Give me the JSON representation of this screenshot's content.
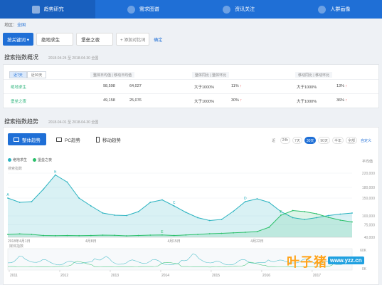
{
  "nav": {
    "tabs": [
      {
        "label": "趋势研究",
        "icon": "chart-icon"
      },
      {
        "label": "需求图谱",
        "icon": "graph-icon"
      },
      {
        "label": "资讯关注",
        "icon": "news-icon"
      },
      {
        "label": "人群画像",
        "icon": "person-icon"
      }
    ]
  },
  "region": {
    "label": "地区：",
    "value": "全国"
  },
  "keywords": {
    "compare_button": "按关键词 ▾",
    "items": [
      "绝地求生",
      "堡垒之夜"
    ],
    "add_label": "+ 添加对比词",
    "confirm": "确定"
  },
  "overview": {
    "title": "搜索指数概况",
    "date": "2018-04-24 至 2018-04-30  全国",
    "toggle": [
      "近7天",
      "近30天"
    ],
    "headers": {
      "index": "整体日均值 | 移动日均值",
      "yoy": "整体同比 | 整体环比",
      "mobile": "移动同比 | 移动环比"
    },
    "rows": [
      {
        "name": "绝地求生",
        "overall": "98,598",
        "mobile": "64,027",
        "yoy": "大于1000%",
        "qoq": "11%",
        "m_yoy": "大于1000%",
        "m_qoq": "13%"
      },
      {
        "name": "堡垒之夜",
        "overall": "49,158",
        "mobile": "25,076",
        "yoy": "大于1000%",
        "qoq": "30%",
        "m_yoy": "大于1000%",
        "m_qoq": "36%"
      }
    ]
  },
  "trend": {
    "title": "搜索指数趋势",
    "date": "2018-04-01 至 2018-04-30  全国",
    "tabs": [
      "整体趋势",
      "PC趋势",
      "移动趋势"
    ],
    "ranges": [
      "近",
      "24h",
      "7天",
      "30天",
      "90天",
      "半年",
      "全部",
      "自定义"
    ],
    "active_range": "30天",
    "avg_label": "平均值",
    "ylabel": "搜索指数"
  },
  "chart_data": {
    "type": "area",
    "x": [
      "2018年4月1日",
      "4/2",
      "4/3",
      "4/4",
      "4/5",
      "4/6",
      "4/7",
      "4/8",
      "4/9",
      "4/10",
      "4/11",
      "4/12",
      "4/13",
      "4/14",
      "4/15",
      "4/16",
      "4/17",
      "4/18",
      "4/19",
      "4/20",
      "4/21",
      "4/22",
      "4/23",
      "4/24",
      "4/25",
      "4/26",
      "4/27",
      "4/28",
      "4/29",
      "4/30"
    ],
    "x_ticks": [
      "2018年4月1日",
      "4月8日",
      "4月15日",
      "4月22日"
    ],
    "series": [
      {
        "name": "绝地求生",
        "color": "#2bb3c0",
        "values": [
          150000,
          138000,
          140000,
          175000,
          215000,
          195000,
          150000,
          128000,
          108000,
          102000,
          101000,
          112000,
          138000,
          145000,
          128000,
          110000,
          95000,
          87000,
          90000,
          113000,
          140000,
          148000,
          138000,
          112000,
          95000,
          90000,
          95000,
          101000,
          105000,
          108000
        ]
      },
      {
        "name": "堡垒之夜",
        "color": "#2bbf6a",
        "values": [
          48000,
          49500,
          48000,
          45000,
          44500,
          45000,
          44500,
          45000,
          46000,
          45500,
          44000,
          45000,
          46000,
          46500,
          45000,
          46500,
          48000,
          50000,
          51000,
          52500,
          54000,
          56000,
          68000,
          102000,
          115000,
          112000,
          106000,
          96000,
          88000,
          83000
        ]
      }
    ],
    "ylim": [
      40000,
      220000
    ],
    "y_ticks": [
      220000,
      180000,
      150000,
      100000,
      75000,
      40000
    ],
    "annotations": [
      "A",
      "B",
      "C",
      "D",
      "E",
      "F"
    ],
    "overview_years": [
      "2011",
      "2012",
      "2013",
      "2014",
      "2015",
      "2016",
      "2017"
    ],
    "overview_y_ticks": [
      "60K",
      "0K"
    ],
    "overview_label": "媒体指数"
  },
  "watermark": {
    "main": "叶子猪",
    "url": "www.yzz.cn"
  }
}
